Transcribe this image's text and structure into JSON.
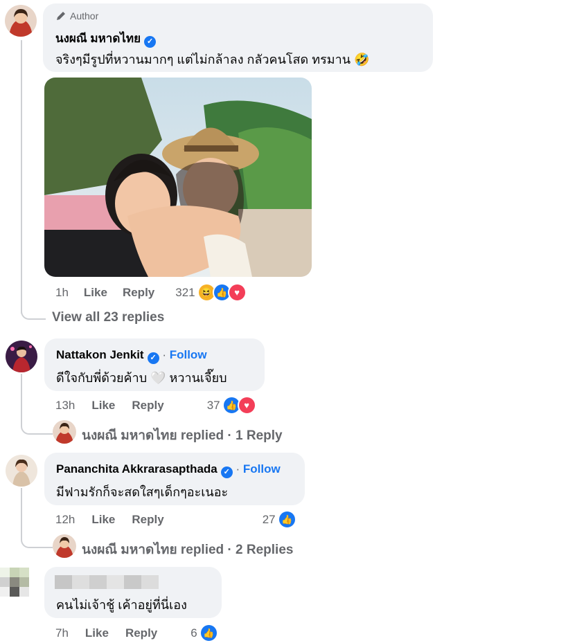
{
  "thread": {
    "author_badge": "Author",
    "comment1": {
      "name": "นงผณี มหาดไทย",
      "text": "จริงๆมีรูปที่หวานมากๆ แต่ไม่กล้าลง กลัวคนโสด ทรมาน 🤣",
      "time": "1h",
      "like": "Like",
      "reply": "Reply",
      "reactions_count": "321",
      "reactions": [
        "haha",
        "like",
        "love"
      ],
      "view_replies": "View all 23 replies"
    },
    "comment2": {
      "name": "Nattakon Jenkit",
      "follow": "Follow",
      "text": "ดีใจกับพี่ด้วยค้าบ 🤍 หวานเจี๊ยบ",
      "time": "13h",
      "like": "Like",
      "reply": "Reply",
      "reactions_count": "37",
      "reactions": [
        "like",
        "love"
      ],
      "reply_summary": "นงผณี มหาดไทย replied · 1 Reply"
    },
    "comment3": {
      "name": "Pananchita Akkrarasapthada",
      "follow": "Follow",
      "text": "มีฟามรักก็จะสดใสๆเด็กๆอะเนอะ",
      "time": "12h",
      "like": "Like",
      "reply": "Reply",
      "reactions_count": "27",
      "reactions": [
        "like"
      ],
      "reply_summary": "นงผณี มหาดไทย replied · 2 Replies"
    },
    "comment4": {
      "text": "คนไม่เจ้าชู้ เค้าอยู่ที่นี่เอง",
      "time": "7h",
      "like": "Like",
      "reply": "Reply",
      "reactions_count": "6",
      "reactions": [
        "like"
      ]
    }
  },
  "icons": {
    "author": "pencil-icon",
    "verified": "verified-badge-icon",
    "like": "like-reaction-icon",
    "love": "love-reaction-icon",
    "haha": "haha-reaction-icon"
  },
  "colors": {
    "bubble": "#f0f2f5",
    "meta_text": "#65676b",
    "accent_blue": "#1877f2",
    "love_red": "#f33e58"
  }
}
